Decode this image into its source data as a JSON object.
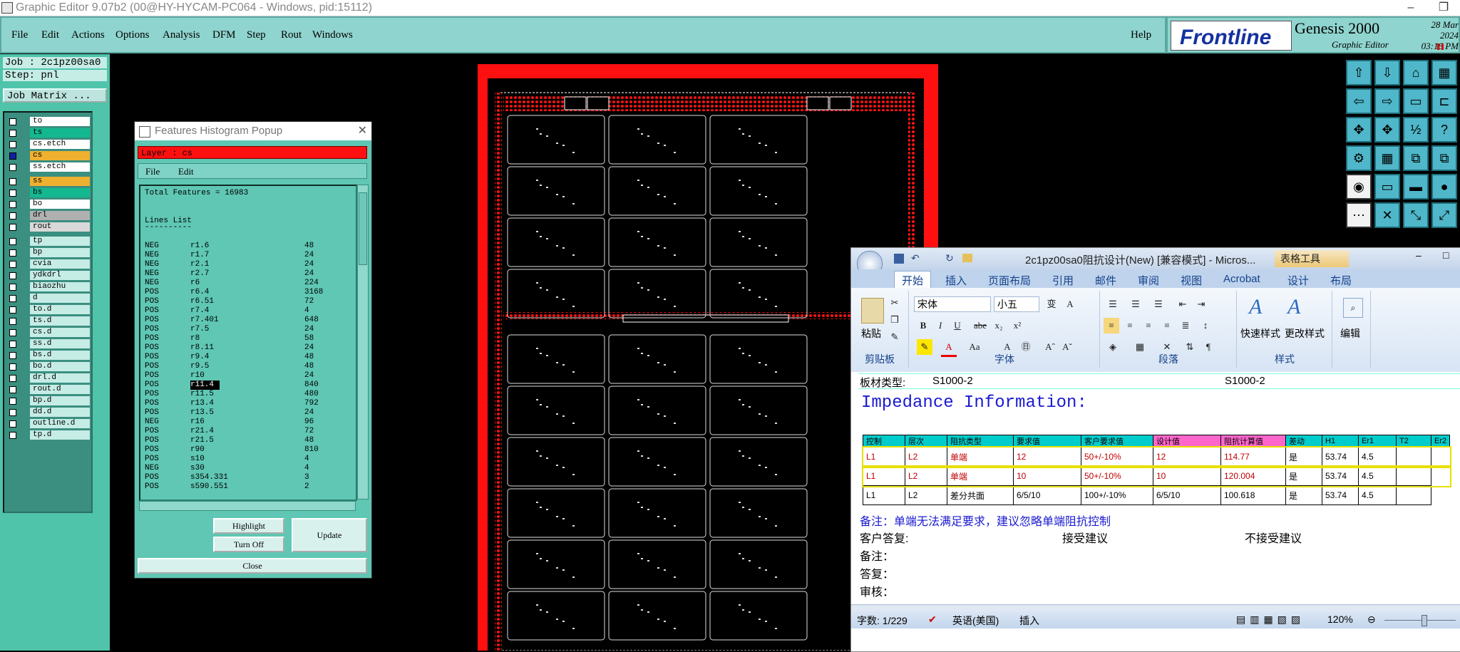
{
  "window": {
    "title": "Graphic Editor 9.07b2 (00@HY-HYCAM-PC064 - Windows, pid:15112)"
  },
  "menubar": {
    "items": [
      "File",
      "Edit",
      "Actions",
      "Options",
      "Analysis",
      "DFM",
      "Step",
      "Rout",
      "Windows"
    ],
    "help": "Help"
  },
  "logo": {
    "brand": "Frontline",
    "product": "Genesis 2000",
    "subtitle": "Graphic Editor",
    "date": "28 Mar 2024",
    "time": "03:16 PM"
  },
  "left": {
    "job": "Job : 2c1pz00sa0",
    "step": "Step: pnl",
    "job_matrix": "Job Matrix ...",
    "layers": [
      {
        "name": "to",
        "color": "#ffffff",
        "checked": false
      },
      {
        "name": "ts",
        "color": "#14b890",
        "checked": false
      },
      {
        "name": "cs.etch",
        "color": "#ffffff",
        "checked": false
      },
      {
        "name": "cs",
        "color": "#f0b030",
        "checked": true
      },
      {
        "name": "ss.etch",
        "color": "#ffffff",
        "checked": false
      },
      {
        "name": "ss",
        "color": "#f0b030",
        "checked": false
      },
      {
        "name": "bs",
        "color": "#14b890",
        "checked": false
      },
      {
        "name": "bo",
        "color": "#ffffff",
        "checked": false
      },
      {
        "name": "drl",
        "color": "#b0b0b0",
        "checked": false
      },
      {
        "name": "rout",
        "color": "#d8d8d8",
        "checked": false
      },
      {
        "name": "tp",
        "color": "#c6ece6",
        "checked": false
      },
      {
        "name": "bp",
        "color": "#c6ece6",
        "checked": false
      },
      {
        "name": "cvia",
        "color": "#c6ece6",
        "checked": false
      },
      {
        "name": "ydkdrl",
        "color": "#c6ece6",
        "checked": false
      },
      {
        "name": "biaozhu",
        "color": "#c6ece6",
        "checked": false
      },
      {
        "name": "d",
        "color": "#c6ece6",
        "checked": false
      },
      {
        "name": "to.d",
        "color": "#c6ece6",
        "checked": false
      },
      {
        "name": "ts.d",
        "color": "#c6ece6",
        "checked": false
      },
      {
        "name": "cs.d",
        "color": "#c6ece6",
        "checked": false
      },
      {
        "name": "ss.d",
        "color": "#c6ece6",
        "checked": false
      },
      {
        "name": "bs.d",
        "color": "#c6ece6",
        "checked": false
      },
      {
        "name": "bo.d",
        "color": "#c6ece6",
        "checked": false
      },
      {
        "name": "drl.d",
        "color": "#c6ece6",
        "checked": false
      },
      {
        "name": "rout.d",
        "color": "#c6ece6",
        "checked": false
      },
      {
        "name": "bp.d",
        "color": "#c6ece6",
        "checked": false
      },
      {
        "name": "dd.d",
        "color": "#c6ece6",
        "checked": false
      },
      {
        "name": "outline.d",
        "color": "#c6ece6",
        "checked": false
      },
      {
        "name": "tp.d",
        "color": "#c6ece6",
        "checked": false
      }
    ]
  },
  "popup": {
    "title": "Features Histogram Popup",
    "layer": "Layer :  cs",
    "menu": [
      "File",
      "Edit"
    ],
    "total": "Total Features = 16983",
    "lines_title": "Lines List",
    "lines_underline": "----------",
    "rows": [
      [
        "NEG",
        "r1.6",
        "48"
      ],
      [
        "NEG",
        "r1.7",
        "24"
      ],
      [
        "NEG",
        "r2.1",
        "24"
      ],
      [
        "NEG",
        "r2.7",
        "24"
      ],
      [
        "NEG",
        "r6",
        "224"
      ],
      [
        "POS",
        "r6.4",
        "3168"
      ],
      [
        "POS",
        "r6.51",
        "72"
      ],
      [
        "POS",
        "r7.4",
        "4"
      ],
      [
        "POS",
        "r7.401",
        "648"
      ],
      [
        "POS",
        "r7.5",
        "24"
      ],
      [
        "POS",
        "r8",
        "58"
      ],
      [
        "POS",
        "r8.11",
        "24"
      ],
      [
        "POS",
        "r9.4",
        "48"
      ],
      [
        "POS",
        "r9.5",
        "48"
      ],
      [
        "POS",
        "r10",
        "24"
      ],
      [
        "POS",
        "r11.4",
        "840"
      ],
      [
        "POS",
        "r11.5",
        "480"
      ],
      [
        "POS",
        "r13.4",
        "792"
      ],
      [
        "POS",
        "r13.5",
        "24"
      ],
      [
        "NEG",
        "r16",
        "96"
      ],
      [
        "POS",
        "r21.4",
        "72"
      ],
      [
        "POS",
        "r21.5",
        "48"
      ],
      [
        "POS",
        "r90",
        "810"
      ],
      [
        "POS",
        "s10",
        "4"
      ],
      [
        "NEG",
        "s30",
        "4"
      ],
      [
        "POS",
        "s354.331",
        "3"
      ],
      [
        "POS",
        "s590.551",
        "2"
      ]
    ],
    "highlight_row": 15,
    "buttons": {
      "highlight": "Highlight",
      "turnoff": "Turn Off",
      "update": "Update",
      "close": "Close"
    }
  },
  "word": {
    "title": "2c1pz00sa0阻抗设计(New) [兼容模式] - Micros...",
    "context_tab": "表格工具",
    "tabs": [
      "开始",
      "插入",
      "页面布局",
      "引用",
      "邮件",
      "审阅",
      "视图",
      "Acrobat",
      "设计",
      "布局"
    ],
    "ribbon": {
      "paste": "粘贴",
      "clipboard": "剪贴板",
      "font_name": "宋体",
      "font_size": "小五",
      "font_group": "字体",
      "para_group": "段落",
      "quick_style": "快速样式",
      "change_style": "更改样式",
      "style_group": "样式",
      "edit": "编辑"
    },
    "doc": {
      "board_label": "板材类型:",
      "board_value1": "S1000-2",
      "board_value2": "S1000-2",
      "heading": "Impedance Information:",
      "header_cells": [
        "控制",
        "层次",
        "阻抗类型",
        "要求值",
        "客户要求值",
        "设计值",
        "阻抗计算值",
        "差动",
        "H1",
        "Er1",
        "T2",
        "Er2"
      ],
      "rows": [
        {
          "c": [
            "L1",
            "L2",
            "单端",
            "12",
            "50+/-10%",
            "12",
            "114.77",
            "是",
            "53.74",
            "4.5",
            ""
          ],
          "red": true
        },
        {
          "c": [
            "L1",
            "L2",
            "单端",
            "10",
            "50+/-10%",
            "10",
            "120.004",
            "是",
            "53.74",
            "4.5",
            ""
          ],
          "red": true
        },
        {
          "c": [
            "L1",
            "L2",
            "差分共面",
            "6/5/10",
            "100+/-10%",
            "6/5/10",
            "100.618",
            "是",
            "53.74",
            "4.5",
            ""
          ],
          "red": false
        }
      ],
      "note": "备注：单端无法满足要求，建议忽略单端阻抗控制",
      "reply_label": "客户答复:",
      "accept": "接受建议",
      "reject": "不接受建议",
      "note2": "备注：",
      "reply2": "答复：",
      "review": "审核："
    },
    "status": {
      "words": "字数: 1/229",
      "lang": "英语(美国)",
      "insert": "插入",
      "zoom": "120%"
    }
  }
}
